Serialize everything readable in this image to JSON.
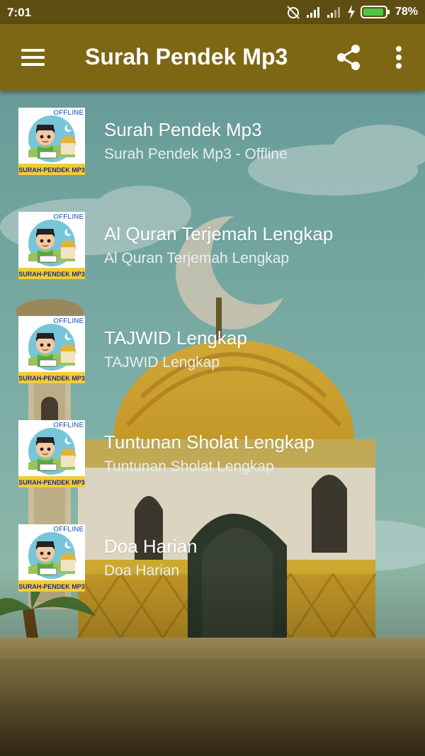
{
  "status_bar": {
    "time": "7:01",
    "battery": "78%",
    "icons": [
      "alarm-off-icon",
      "signal-icon",
      "signal-icon",
      "charging-icon",
      "battery-icon"
    ]
  },
  "app_bar": {
    "title": "Surah Pendek Mp3",
    "icons": [
      "menu-icon",
      "share-icon",
      "more-vert-icon"
    ],
    "color": "#7d6715"
  },
  "thumbnail": {
    "badge": "OFFLINE",
    "caption": "SURAH-PENDEK MP3"
  },
  "items": [
    {
      "title": "Surah Pendek Mp3",
      "subtitle": "Surah Pendek Mp3 - Offline"
    },
    {
      "title": "Al Quran Terjemah Lengkap",
      "subtitle": "Al Quran Terjemah Lengkap"
    },
    {
      "title": "TAJWID Lengkap",
      "subtitle": "TAJWID Lengkap"
    },
    {
      "title": "Tuntunan Sholat Lengkap",
      "subtitle": "Tuntunan Sholat Lengkap"
    },
    {
      "title": "Doa Harian",
      "subtitle": "Doa Harian"
    }
  ]
}
